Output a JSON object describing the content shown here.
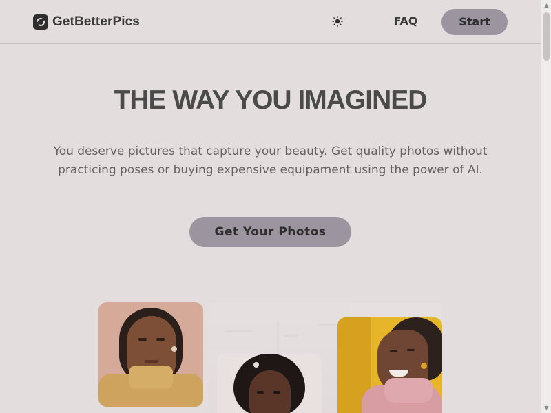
{
  "header": {
    "brand_name": "GetBetterPics",
    "logo_icon": "logo-icon",
    "theme_toggle_icon": "sun-icon",
    "nav": {
      "faq_label": "FAQ",
      "start_label": "Start"
    }
  },
  "hero": {
    "title": "THE WAY YOU IMAGINED",
    "subtitle": "You deserve pictures that capture your beauty. Get quality photos without practicing poses or buying expensive equipament using the power of AI.",
    "cta_label": "Get Your Photos"
  },
  "gallery": {
    "photos": [
      {
        "name": "portrait-photo-1",
        "background": "#d5aa98"
      },
      {
        "name": "portrait-photo-2",
        "background": "#e8e1df"
      },
      {
        "name": "portrait-photo-3",
        "background": "#e7b529"
      }
    ]
  },
  "colors": {
    "page_bg": "#e3dddd",
    "accent_button": "#9c949f",
    "text_dark": "#3f3f3f",
    "text_muted": "#666062"
  }
}
